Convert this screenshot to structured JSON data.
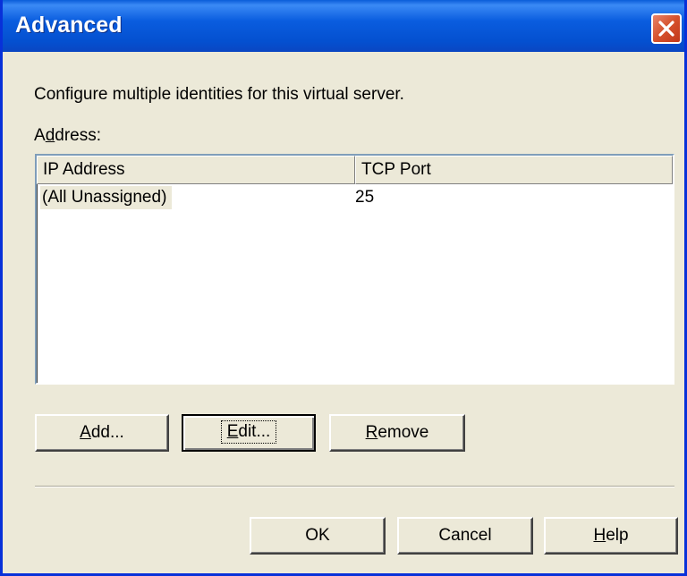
{
  "window": {
    "title": "Advanced"
  },
  "description": "Configure multiple identities for this virtual server.",
  "address_label": {
    "prefix": "A",
    "accel": "d",
    "rest": "dress:"
  },
  "list": {
    "columns": [
      "IP Address",
      "TCP Port"
    ],
    "rows": [
      {
        "ip": "(All Unassigned)",
        "port": "25"
      }
    ]
  },
  "buttons": {
    "add": {
      "accel": "A",
      "rest": "dd..."
    },
    "edit": {
      "accel": "E",
      "rest": "dit..."
    },
    "remove": {
      "accel": "R",
      "rest": "emove"
    },
    "ok": "OK",
    "cancel": "Cancel",
    "help": {
      "accel": "H",
      "rest": "elp"
    }
  },
  "icons": {
    "close": "close-icon"
  },
  "colors": {
    "titlebar": "#0a5dd8",
    "window_bg": "#ece9d8",
    "close_button": "#d5512c"
  }
}
